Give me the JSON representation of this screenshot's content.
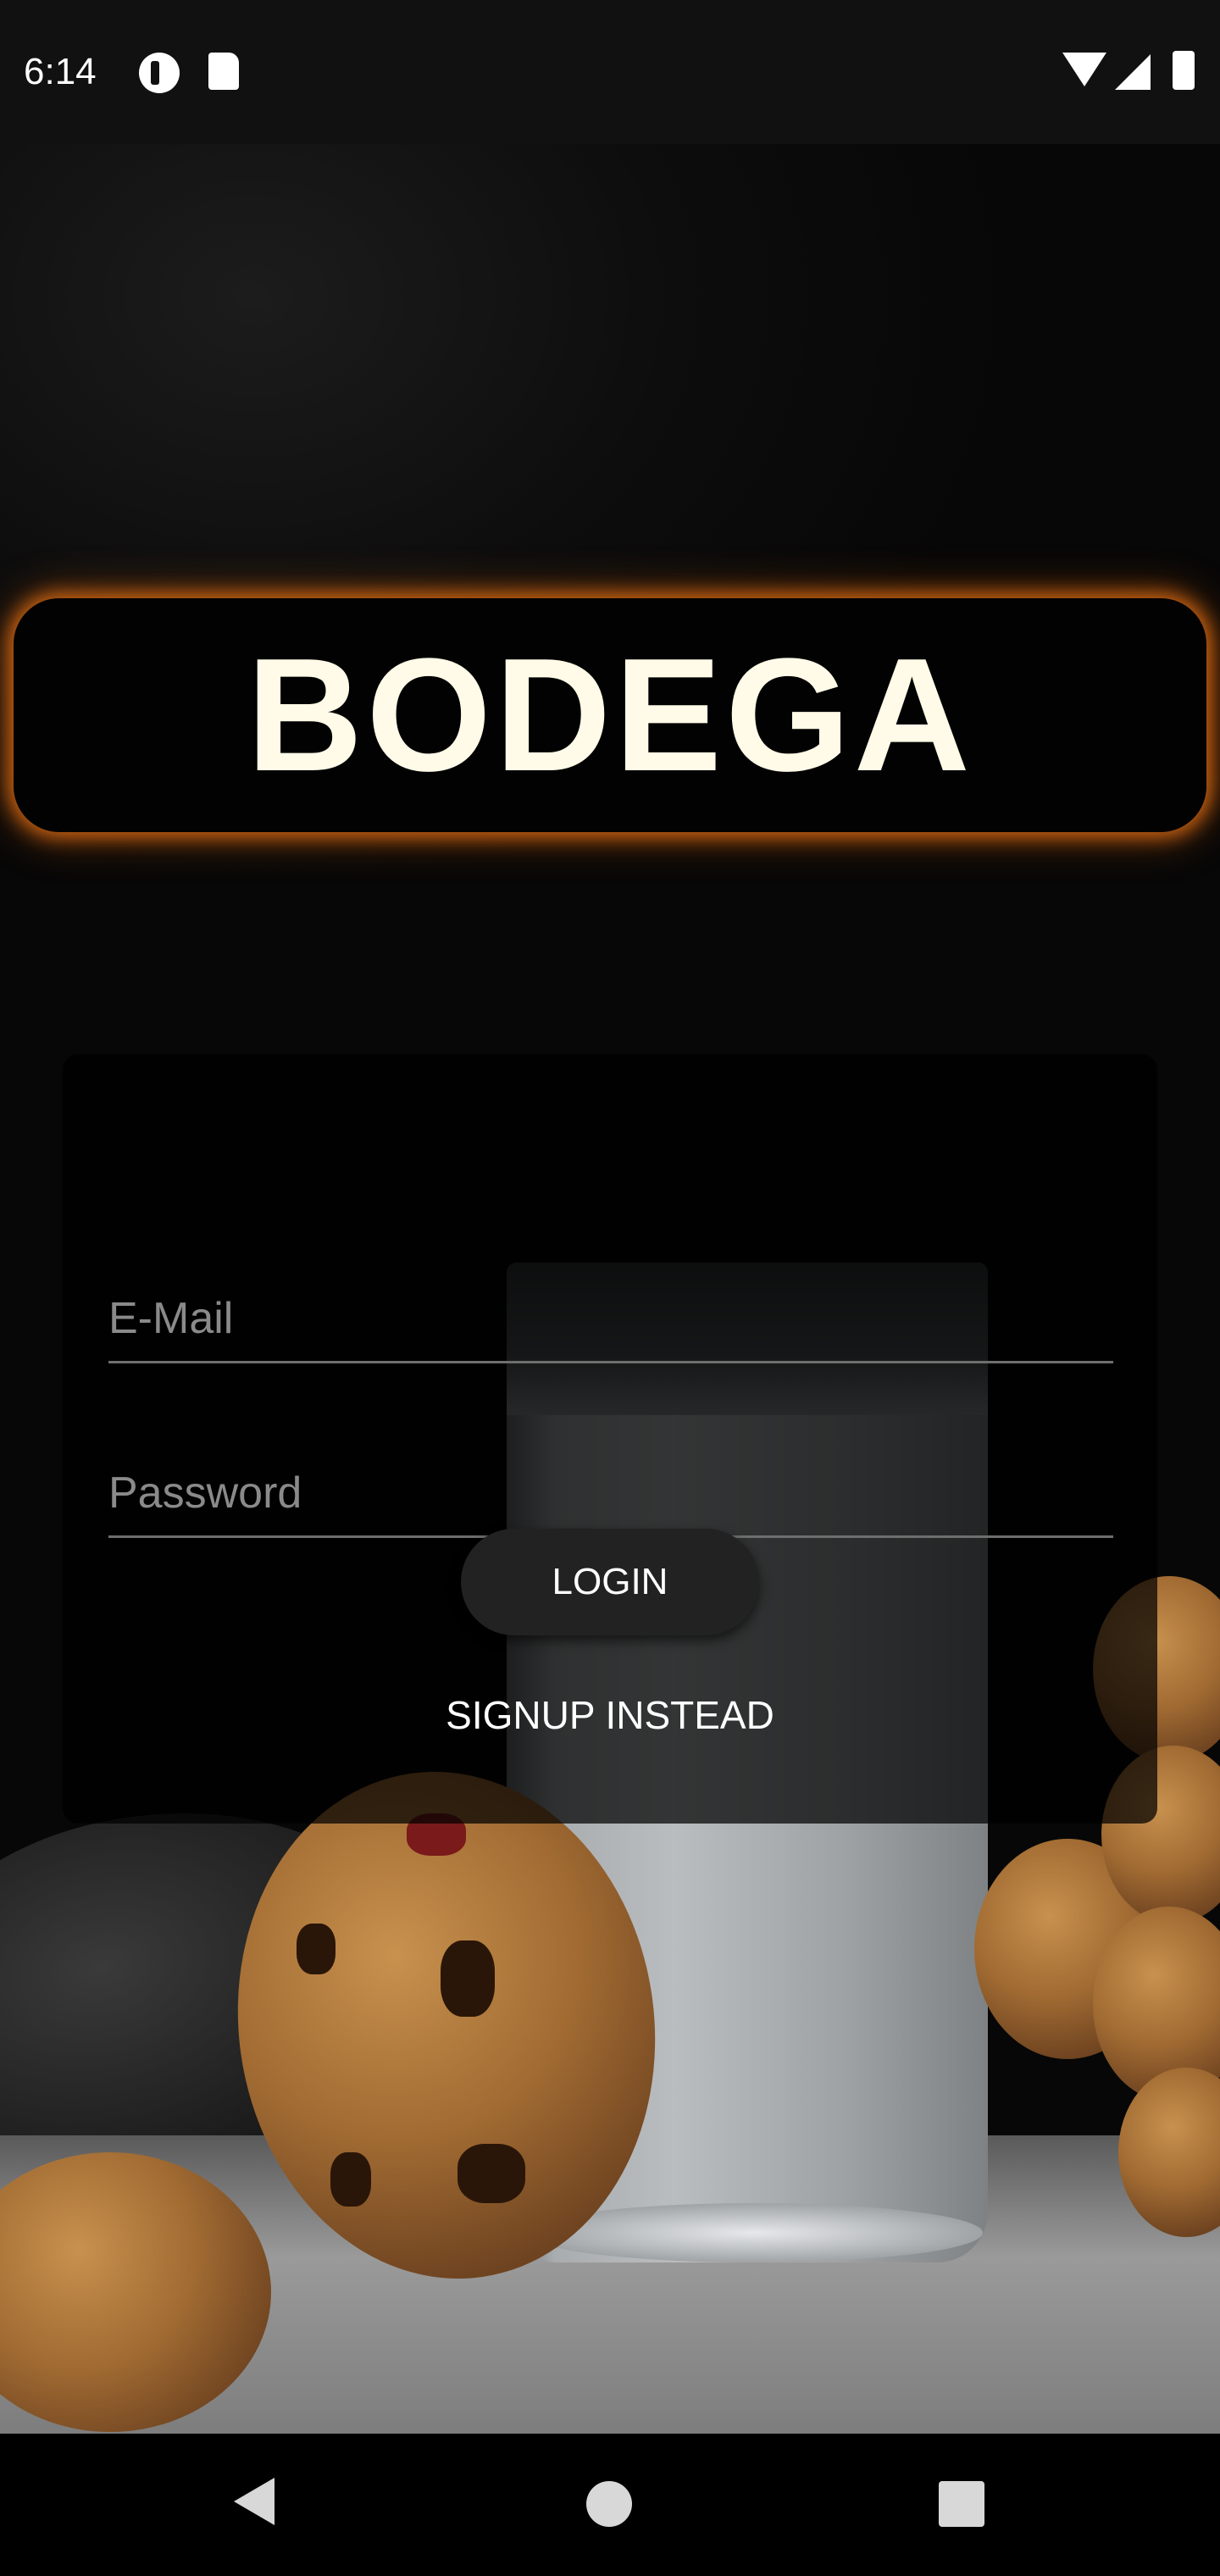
{
  "status_bar": {
    "time": "6:14",
    "icons": [
      "pocket-casts-icon",
      "sd-card-icon",
      "wifi-icon",
      "signal-icon",
      "battery-icon"
    ]
  },
  "app": {
    "title": "BODEGA",
    "title_color": "#fffbe8",
    "glow_color": "#e26e14"
  },
  "login_form": {
    "email_placeholder": "E-Mail",
    "email_value": "",
    "password_placeholder": "Password",
    "password_value": "",
    "login_label": "LOGIN",
    "signup_label": "SIGNUP INSTEAD"
  },
  "nav_bar": {
    "icons": [
      "back-icon",
      "home-icon",
      "recents-icon"
    ]
  }
}
